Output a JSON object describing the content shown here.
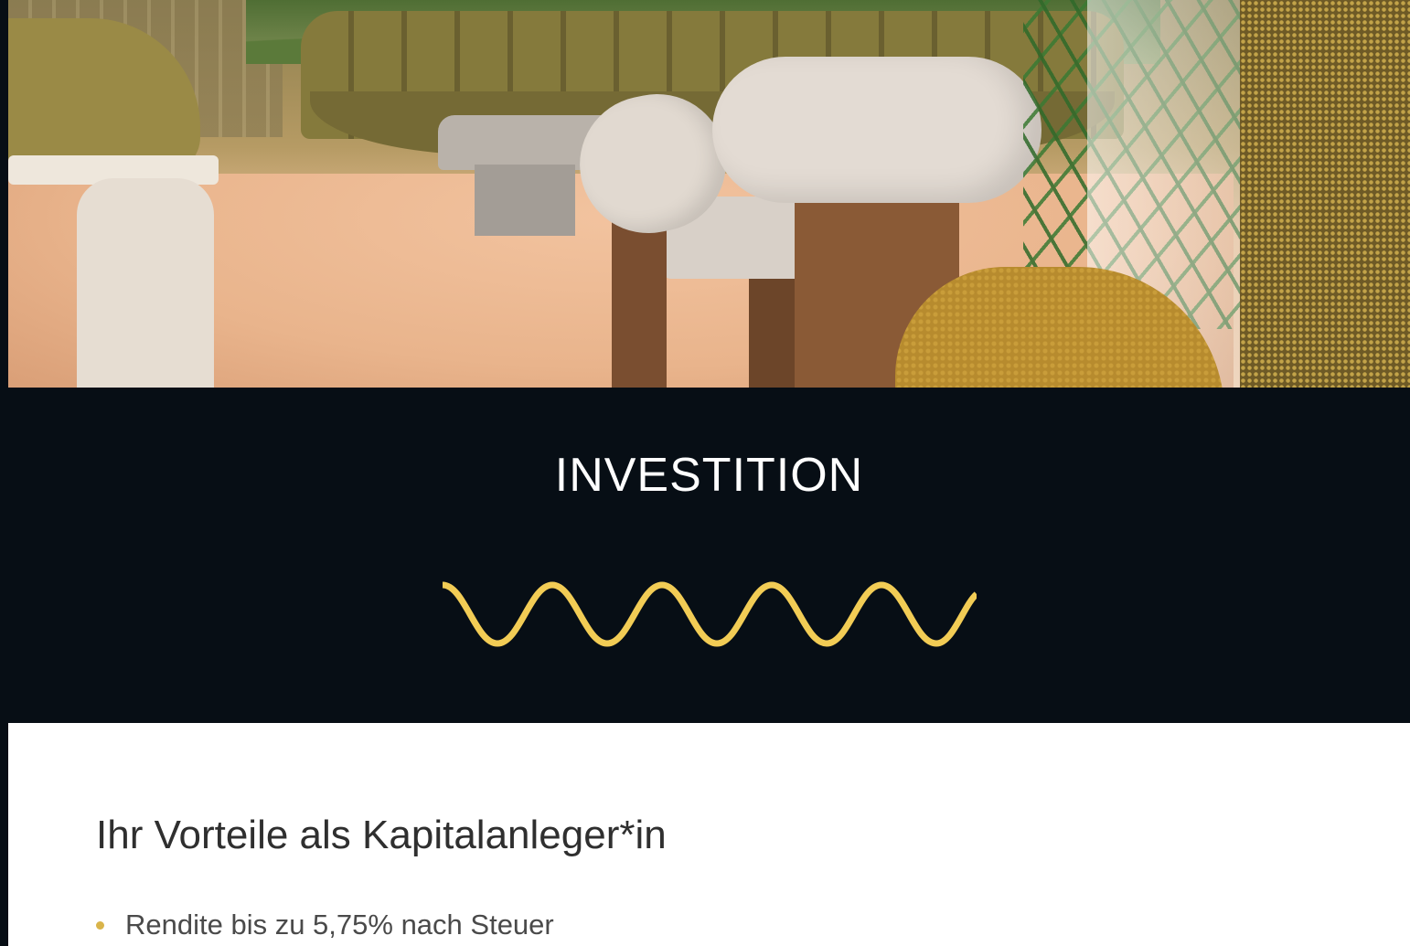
{
  "hero": {
    "image_description_icon": "lounge-interior-photo-icon"
  },
  "section": {
    "title": "INVESTITION",
    "divider_icon": "wave-divider-icon",
    "accent_color": "#f2cc55",
    "background_color": "#070e15"
  },
  "content": {
    "heading": "Ihr Vorteile als Kapitalanleger*in",
    "bullet_color": "#d9b44a",
    "benefits": [
      "Rendite bis zu 5,75% nach Steuer"
    ]
  }
}
